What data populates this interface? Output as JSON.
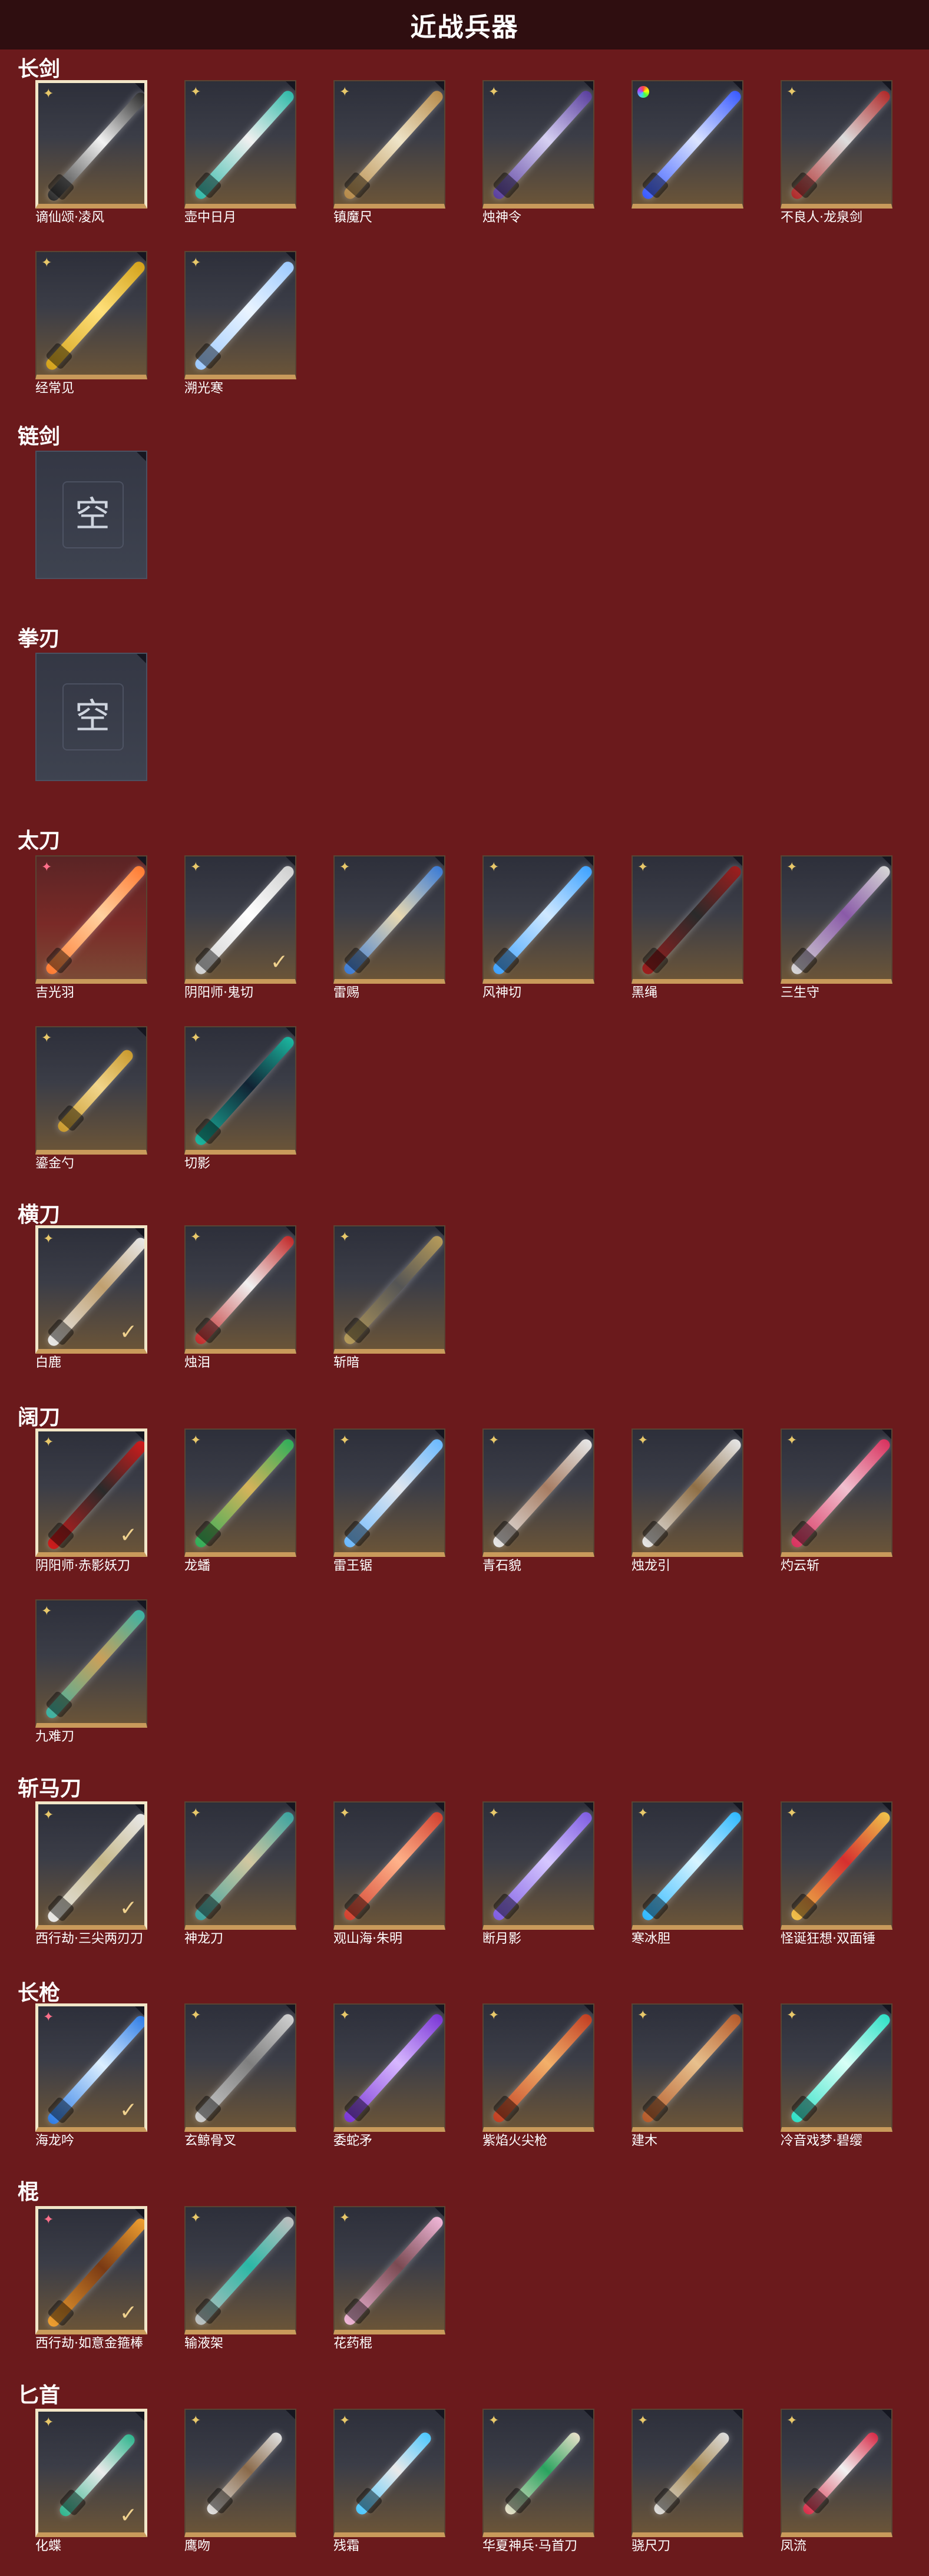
{
  "title": "近战兵器",
  "empty_label": "空",
  "check_mark": "✓",
  "categories": [
    {
      "name": "长剑",
      "items": [
        {
          "label": "谪仙颂·凌风",
          "rarity": "gold",
          "selected": true,
          "colors": [
            "#2a2a2a",
            "#f2f2f2"
          ]
        },
        {
          "label": "壶中日月",
          "rarity": "gold",
          "colors": [
            "#2fb9a8",
            "#f0f0f0"
          ]
        },
        {
          "label": "镇魔尺",
          "rarity": "gold",
          "colors": [
            "#b68a4a",
            "#eee4c8"
          ]
        },
        {
          "label": "烛神令",
          "rarity": "gold",
          "colors": [
            "#5a3f9e",
            "#d6d0f2"
          ]
        },
        {
          "label": "",
          "rarity": "rainbow",
          "colors": [
            "#3a5bff",
            "#dbe4ff"
          ]
        },
        {
          "label": "不良人·龙泉剑",
          "rarity": "gold",
          "colors": [
            "#b02a2a",
            "#dddddd"
          ]
        },
        {
          "label": "经常见",
          "rarity": "gold",
          "colors": [
            "#d4a21a",
            "#ffe07a"
          ]
        },
        {
          "label": "溯光寒",
          "rarity": "gold",
          "colors": [
            "#9cc9ff",
            "#eaf4ff"
          ]
        }
      ]
    },
    {
      "name": "链剑",
      "empty": true,
      "items": [
        {
          "label": ""
        }
      ]
    },
    {
      "name": "拳刃",
      "empty": true,
      "items": [
        {
          "label": ""
        }
      ]
    },
    {
      "name": "太刀",
      "items": [
        {
          "label": "吉光羽",
          "rarity": "pink",
          "red": true,
          "colors": [
            "#ff7b32",
            "#ffd1a0"
          ]
        },
        {
          "label": "阴阳师·鬼切",
          "rarity": "gold",
          "check": true,
          "colors": [
            "#cfcfcf",
            "#ffffff"
          ]
        },
        {
          "label": "雷赐",
          "rarity": "gold",
          "colors": [
            "#3a7bd6",
            "#e8d8b0"
          ]
        },
        {
          "label": "风神切",
          "rarity": "gold",
          "colors": [
            "#3ea2ff",
            "#cfe8ff"
          ]
        },
        {
          "label": "黑绳",
          "rarity": "gold",
          "colors": [
            "#9e1d1d",
            "#2a2a2a"
          ]
        },
        {
          "label": "三生守",
          "rarity": "gold",
          "colors": [
            "#d6d6d6",
            "#8a5aa8"
          ]
        },
        {
          "label": "鎏金勺",
          "rarity": "gold",
          "colors": [
            "#c99a2e",
            "#f1d58b"
          ],
          "short": true
        },
        {
          "label": "切影",
          "rarity": "gold",
          "colors": [
            "#1bb7a0",
            "#123"
          ]
        }
      ]
    },
    {
      "name": "横刀",
      "items": [
        {
          "label": "白鹿",
          "rarity": "gold",
          "selected": true,
          "check": true,
          "colors": [
            "#e8e8e8",
            "#c0a070"
          ]
        },
        {
          "label": "烛泪",
          "rarity": "gold",
          "colors": [
            "#c22a2a",
            "#f0f0f0"
          ]
        },
        {
          "label": "斩暗",
          "rarity": "gold",
          "colors": [
            "#b69b5a",
            "#555"
          ]
        }
      ]
    },
    {
      "name": "阔刀",
      "items": [
        {
          "label": "阴阳师·赤影妖刀",
          "rarity": "gold",
          "selected": true,
          "check": true,
          "colors": [
            "#d11b1b",
            "#2a2a2a"
          ]
        },
        {
          "label": "龙蟠",
          "rarity": "gold",
          "colors": [
            "#2fae5a",
            "#d6b35a"
          ]
        },
        {
          "label": "雷王锯",
          "rarity": "gold",
          "colors": [
            "#6bb9ff",
            "#e0e6ee"
          ]
        },
        {
          "label": "青石貌",
          "rarity": "gold",
          "colors": [
            "#e7e7e7",
            "#a77d63"
          ]
        },
        {
          "label": "烛龙引",
          "rarity": "gold",
          "colors": [
            "#e6e6e6",
            "#8f6f46"
          ]
        },
        {
          "label": "灼云斩",
          "rarity": "gold",
          "colors": [
            "#d8325e",
            "#f1c0cf"
          ]
        },
        {
          "label": "九难刀",
          "rarity": "gold",
          "colors": [
            "#3bb2a4",
            "#caa05a"
          ]
        }
      ]
    },
    {
      "name": "斩马刀",
      "items": [
        {
          "label": "西行劫·三尖两刃刀",
          "rarity": "gold",
          "selected": true,
          "check": true,
          "colors": [
            "#e8e8e8",
            "#c7b98a"
          ]
        },
        {
          "label": "神龙刀",
          "rarity": "gold",
          "colors": [
            "#3aa3a0",
            "#d2c7a0"
          ]
        },
        {
          "label": "观山海·朱明",
          "rarity": "gold",
          "colors": [
            "#d2402f",
            "#ffb28a"
          ]
        },
        {
          "label": "断月影",
          "rarity": "gold",
          "colors": [
            "#7f5de2",
            "#d6c7ff"
          ]
        },
        {
          "label": "寒冰胆",
          "rarity": "gold",
          "colors": [
            "#2fb8ff",
            "#d7f4ff"
          ]
        },
        {
          "label": "怪诞狂想·双面锤",
          "rarity": "gold",
          "colors": [
            "#f0c24a",
            "#d62f2f"
          ]
        }
      ]
    },
    {
      "name": "长枪",
      "items": [
        {
          "label": "海龙吟",
          "rarity": "pink",
          "selected": true,
          "check": true,
          "colors": [
            "#2f7de6",
            "#dcefff"
          ]
        },
        {
          "label": "玄鲸骨叉",
          "rarity": "gold",
          "colors": [
            "#cfcfcf",
            "#7f7f7f"
          ]
        },
        {
          "label": "委蛇矛",
          "rarity": "gold",
          "colors": [
            "#7a36d6",
            "#d7b7ff"
          ]
        },
        {
          "label": "紫焰火尖枪",
          "rarity": "gold",
          "colors": [
            "#c23e22",
            "#f2b06a"
          ]
        },
        {
          "label": "建木",
          "rarity": "gold",
          "colors": [
            "#b55a2a",
            "#e7c08d"
          ]
        },
        {
          "label": "冷音戏梦·碧缨",
          "rarity": "gold",
          "colors": [
            "#2fe0c6",
            "#d8fff6"
          ]
        }
      ]
    },
    {
      "name": "棍",
      "items": [
        {
          "label": "西行劫·如意金箍棒",
          "rarity": "pink",
          "selected": true,
          "check": true,
          "colors": [
            "#f0a030",
            "#7a3a14"
          ]
        },
        {
          "label": "输液架",
          "rarity": "gold",
          "colors": [
            "#bfbfbf",
            "#2bb8a6"
          ]
        },
        {
          "label": "花药棍",
          "rarity": "gold",
          "colors": [
            "#f0b7d8",
            "#7a4a52"
          ]
        }
      ]
    },
    {
      "name": "匕首",
      "items": [
        {
          "label": "化蝶",
          "rarity": "gold",
          "selected": true,
          "check": true,
          "colors": [
            "#30b58e",
            "#eaeaea"
          ],
          "short": true
        },
        {
          "label": "鹰吻",
          "rarity": "gold",
          "colors": [
            "#e0e0e0",
            "#8a6a4a"
          ],
          "short": true
        },
        {
          "label": "残霜",
          "rarity": "gold",
          "colors": [
            "#4cc8ff",
            "#e9e9e9"
          ],
          "short": true
        },
        {
          "label": "华夏神兵·马首刀",
          "rarity": "gold",
          "colors": [
            "#e8e0c9",
            "#2aa35f"
          ],
          "short": true
        },
        {
          "label": "骁尺刀",
          "rarity": "gold",
          "colors": [
            "#dcdcdc",
            "#aa8b52"
          ],
          "short": true
        },
        {
          "label": "凤流",
          "rarity": "gold",
          "colors": [
            "#d82c48",
            "#f1f1f1"
          ],
          "short": true
        }
      ]
    }
  ]
}
